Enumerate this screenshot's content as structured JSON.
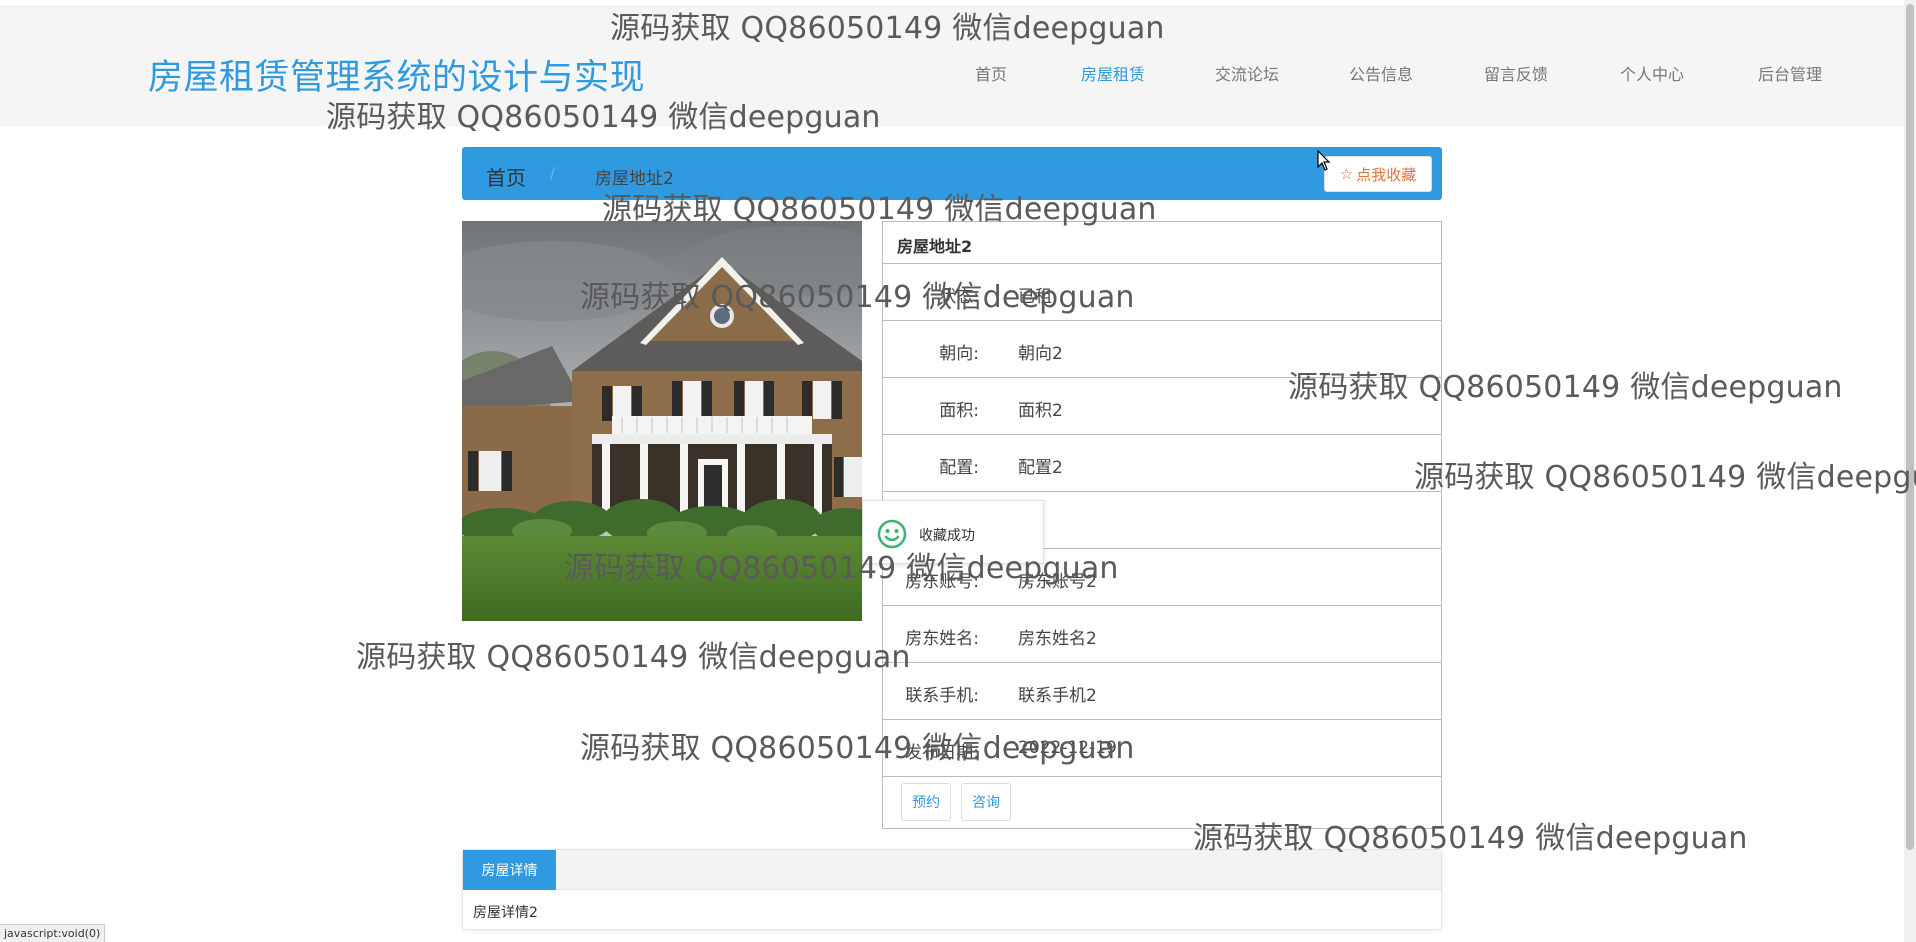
{
  "site": {
    "title": "房屋租赁管理系统的设计与实现"
  },
  "nav": [
    {
      "label": "首页",
      "active": false
    },
    {
      "label": "房屋租赁",
      "active": true
    },
    {
      "label": "交流论坛",
      "active": false
    },
    {
      "label": "公告信息",
      "active": false
    },
    {
      "label": "留言反馈",
      "active": false
    },
    {
      "label": "个人中心",
      "active": false
    },
    {
      "label": "后台管理",
      "active": false
    }
  ],
  "breadcrumb": {
    "home": "首页",
    "separator": "/",
    "current": "房屋地址2"
  },
  "favorite_button": {
    "icon": "star-outline-icon",
    "label": "点我收藏"
  },
  "house": {
    "title": "房屋地址2",
    "fields": [
      {
        "label": "状态:",
        "value": "已租"
      },
      {
        "label": "朝向:",
        "value": "朝向2"
      },
      {
        "label": "面积:",
        "value": "面积2"
      },
      {
        "label": "配置:",
        "value": "配置2"
      },
      {
        "label": "",
        "value": ""
      },
      {
        "label": "房东账号:",
        "value": "房东账号2"
      },
      {
        "label": "房东姓名:",
        "value": "房东姓名2"
      },
      {
        "label": "联系手机:",
        "value": "联系手机2"
      },
      {
        "label": "发布日期:",
        "value": "2022-12-19"
      }
    ],
    "actions": [
      "预约",
      "咨询"
    ]
  },
  "toast": {
    "icon": "smiley-icon",
    "text": "收藏成功"
  },
  "detail": {
    "tab": "房屋详情",
    "content": "房屋详情2"
  },
  "status_bar": "javascript:void(0)",
  "watermark": "源码获取 QQ86050149 微信deepguan",
  "colors": {
    "accent": "#2f9ae0",
    "favorite": "#e0743f",
    "toast_icon": "#3cb371"
  }
}
